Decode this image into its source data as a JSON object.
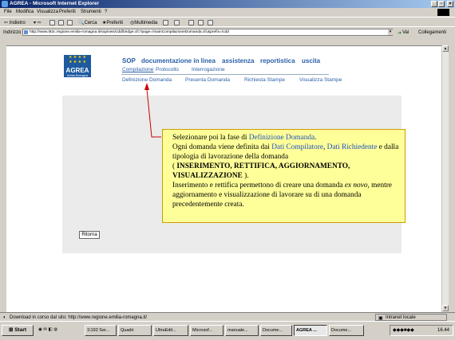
{
  "window": {
    "title": "AGREA - Microsoft Internet Explorer",
    "min": "_",
    "max": "▫",
    "close": "×"
  },
  "menu": [
    "File",
    "Modifica",
    "Visualizza",
    "Preferiti",
    "Strumenti",
    "?"
  ],
  "toolbar": {
    "back": "Indietro",
    "search": "Cerca",
    "favorites": "Preferiti",
    "media": "Multimedia"
  },
  "address": {
    "label": "Indirizzo",
    "url": "http://www.t92c.regione.emilia-romagna.it/sopinws/cdd/bridge.cfc?page=/mainCompilazioneDomanda.cfc&prefix=/cdd",
    "go": "Vai",
    "links": "Collegamenti"
  },
  "page": {
    "logo": {
      "word": "AGREA",
      "sub": "Emilia-Romagna"
    },
    "nav_primary": [
      "SOP",
      "documentazione in linea",
      "assistenza",
      "reportistica",
      "uscita"
    ],
    "nav_secondary": [
      "Compilazione",
      "Protocollo",
      "Interrogazione"
    ],
    "nav_tertiary": [
      "Definizione Domanda",
      "Presenta Domanda",
      "Richiesta Stampe",
      "Visualizza Stampe"
    ],
    "back_button": "Ritorna"
  },
  "callout": {
    "line1_pre": "Selezionare poi la fase di ",
    "line1_hl": "Definizione Domanda",
    "line1_post": ".",
    "line2_pre": "Ogni domanda viene definita dai ",
    "line2_hl1": "Dati Compilatore",
    "line2_mid": ", ",
    "line2_hl2": "Dati Richiedente",
    "line2_post": " e dalla tipologia di lavorazione della domanda",
    "line3_pre": "( ",
    "line3_bold": "INSERIMENTO, RETTIFICA, AGGIORNAMENTO, VISUALIZZAZIONE",
    "line3_post": " ).",
    "line4_pre": "Inserimento e rettifica permettono di creare una domanda ",
    "line4_ital": "ex novo",
    "line4_post": ", mentre aggiornamento e visualizzazione di lavorare su di una domanda precedentemente creata."
  },
  "status": {
    "text": "Download in corso dal sito: http://www.regione.emilia-romagna.it/",
    "zone": "Intranet locale"
  },
  "taskbar": {
    "start": "Start",
    "tasks": [
      "1\\192 Ser...",
      "Quadri",
      "UltraEdit...",
      "Microsof...",
      "manuale...",
      "Docume...",
      "AGREA ...",
      "Docume..."
    ],
    "active_task": 6,
    "clock": "16.44"
  },
  "colors": {
    "link": "#2a5fa8",
    "callout_bg": "#ffff99",
    "callout_highlight": "#1f4fbf",
    "arrow": "#cc0000"
  }
}
